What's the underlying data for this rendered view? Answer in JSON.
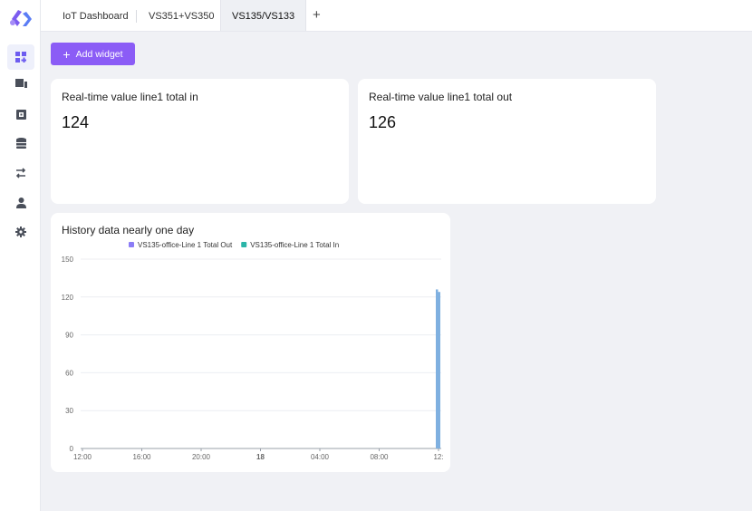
{
  "app": {
    "logo_icon": "brand-logo-icon",
    "accent": "#8b5cf6"
  },
  "sidebar": {
    "items": [
      {
        "name": "dashboard",
        "icon": "dashboard-grid-icon",
        "active": true
      },
      {
        "name": "devices",
        "icon": "device-icon",
        "active": false
      },
      {
        "name": "device-template",
        "icon": "chip-box-icon",
        "active": false
      },
      {
        "name": "database",
        "icon": "database-icon",
        "active": false
      },
      {
        "name": "workflow",
        "icon": "swap-arrows-icon",
        "active": false
      },
      {
        "name": "user",
        "icon": "user-icon",
        "active": false
      },
      {
        "name": "settings",
        "icon": "gear-icon",
        "active": false
      }
    ]
  },
  "tabs": [
    {
      "label": "IoT Dashboard",
      "active": false
    },
    {
      "label": "VS351+VS350",
      "active": false
    },
    {
      "label": "VS135/VS133",
      "active": true
    }
  ],
  "tab_add_label": "+",
  "toolbar": {
    "add_widget_label": "Add widget",
    "add_widget_icon": "+"
  },
  "widgets": {
    "line_in": {
      "title": "Real-time value line1 total in",
      "value": "124"
    },
    "line_out": {
      "title": "Real-time value line1 total out",
      "value": "126"
    }
  },
  "history": {
    "title": "History data nearly one day"
  },
  "chart_data": {
    "type": "bar",
    "title": "History data nearly one day",
    "x_tick_labels": [
      "12:00",
      "16:00",
      "20:00",
      "18",
      "04:00",
      "08:00",
      "12:"
    ],
    "y_tick_labels": [
      "0",
      "30",
      "60",
      "90",
      "120",
      "150"
    ],
    "ylim": [
      0,
      150
    ],
    "grid": true,
    "legend_position": "top",
    "series": [
      {
        "name": "VS135-office-Line 1 Total Out",
        "color": "#8b7cf6",
        "values": [
          126
        ]
      },
      {
        "name": "VS135-office-Line 1 Total In",
        "color": "#2bb5a8",
        "values": [
          124
        ]
      }
    ],
    "bar_color_rendered": "#7fb0e0"
  }
}
